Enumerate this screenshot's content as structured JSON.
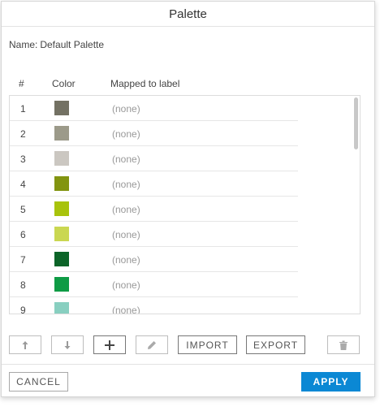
{
  "dialog": {
    "title": "Palette"
  },
  "name": {
    "label": "Name:",
    "value": "Default Palette"
  },
  "columns": {
    "index": "#",
    "color": "Color",
    "mapped": "Mapped to label"
  },
  "rows": [
    {
      "index": "1",
      "color": "#737163",
      "mapped": "(none)"
    },
    {
      "index": "2",
      "color": "#9c9a8a",
      "mapped": "(none)"
    },
    {
      "index": "3",
      "color": "#cbc7c1",
      "mapped": "(none)"
    },
    {
      "index": "4",
      "color": "#829410",
      "mapped": "(none)"
    },
    {
      "index": "5",
      "color": "#a8c30c",
      "mapped": "(none)"
    },
    {
      "index": "6",
      "color": "#cad751",
      "mapped": "(none)"
    },
    {
      "index": "7",
      "color": "#0c6428",
      "mapped": "(none)"
    },
    {
      "index": "8",
      "color": "#0e9b45",
      "mapped": "(none)"
    },
    {
      "index": "9",
      "color": "#88cfc0",
      "mapped": "(none)"
    }
  ],
  "toolbar": {
    "move_up_icon": "arrow-up-icon",
    "move_down_icon": "arrow-down-icon",
    "add_icon": "plus-icon",
    "edit_icon": "pencil-icon",
    "import_label": "IMPORT",
    "export_label": "EXPORT",
    "delete_icon": "trash-icon"
  },
  "footer": {
    "cancel_label": "CANCEL",
    "apply_label": "APPLY"
  },
  "colors": {
    "accent": "#0b88d4"
  }
}
